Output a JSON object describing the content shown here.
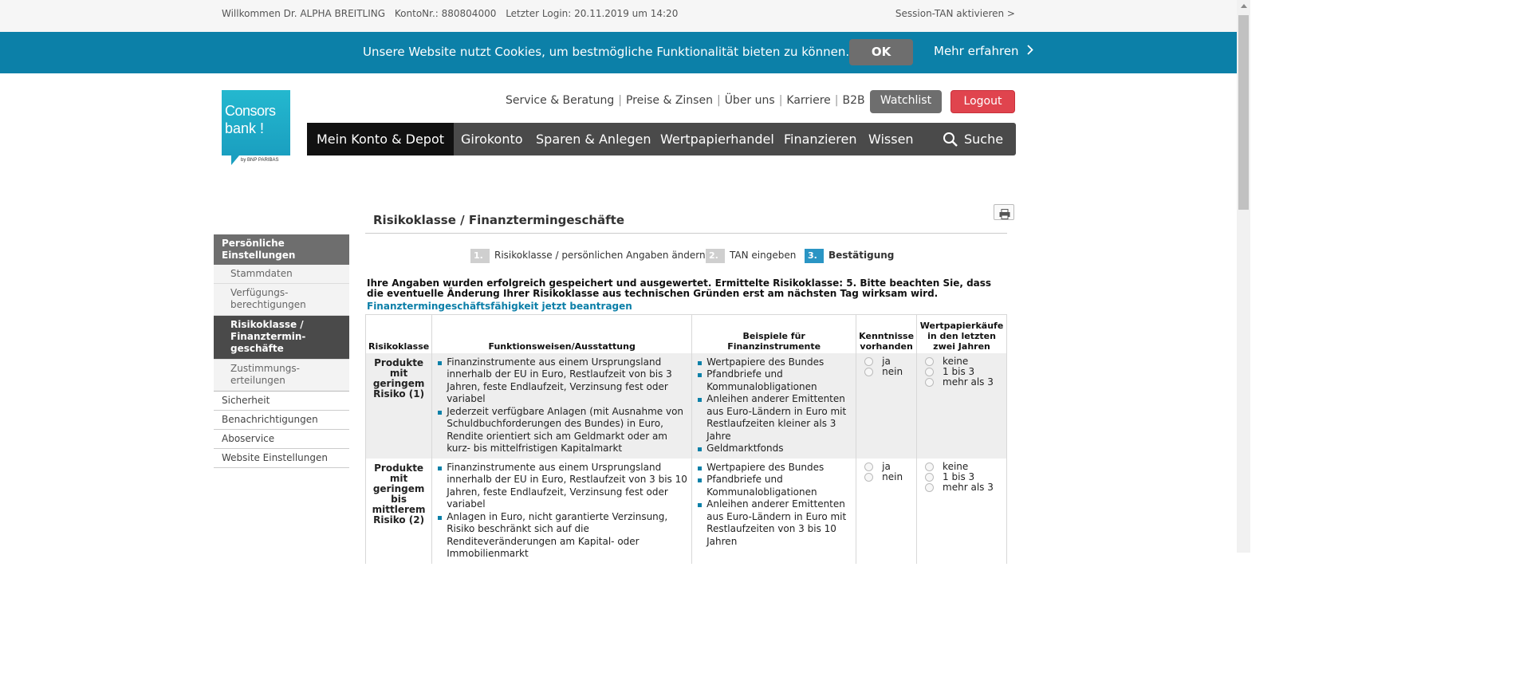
{
  "topbar": {
    "welcome": "Willkommen Dr. ALPHA BREITLING",
    "konto": "KontoNr.: 880804000",
    "login": "Letzter Login: 20.11.2019 um 14:20",
    "session": "Session-TAN aktivieren >"
  },
  "cookie": {
    "message": "Unsere Website nutzt Cookies, um bestmögliche Funktionalität bieten zu können.",
    "ok": "OK",
    "more": "Mehr erfahren"
  },
  "logo": {
    "line1": "Consors",
    "line2": "bank !",
    "sub": "by BNP PARIBAS"
  },
  "service": {
    "links": [
      "Service & Beratung",
      "Preise & Zinsen",
      "Über uns",
      "Karriere",
      "B2B"
    ],
    "watchlist": "Watchlist",
    "logout": "Logout"
  },
  "nav": {
    "items": [
      "Mein Konto & Depot",
      "Girokonto",
      "Sparen & Anlegen",
      "Wertpapierhandel",
      "Finanzieren",
      "Wissen"
    ],
    "search": "Suche"
  },
  "sidebar": {
    "section": "Persönliche Einstellungen",
    "subitems": [
      "Stammdaten",
      "Verfügungs-berechtigungen",
      "Risikoklasse / Finanztermin-geschäfte",
      "Zustimmungs-erteilungen"
    ],
    "items": [
      "Sicherheit",
      "Benachrichtigungen",
      "Aboservice",
      "Website Einstellungen"
    ]
  },
  "page": {
    "title": "Risikoklasse / Finanztermingeschäfte",
    "steps": [
      {
        "num": "1.",
        "label": "Risikoklasse / persönlichen Angaben ändern"
      },
      {
        "num": "2.",
        "label": "TAN eingeben"
      },
      {
        "num": "3.",
        "label": "Bestätigung"
      }
    ],
    "notice": "Ihre Angaben wurden erfolgreich gespeichert und ausgewertet. Ermittelte Risikoklasse: 5. Bitte beachten Sie, dass die eventuelle Änderung Ihrer Risikoklasse aus technischen Gründen erst am nächsten Tag wirksam wird.",
    "link": "Finanztermingeschäftsfähigkeit jetzt beantragen"
  },
  "table": {
    "headers": [
      "Risikoklasse",
      "Funktionsweisen/Ausstattung",
      "Beispiele für Finanzinstrumente",
      "Kenntnisse vorhanden",
      "Wertpapierkäufe in den letzten zwei Jahren"
    ],
    "rows": [
      {
        "class": "Produkte mit geringem Risiko (1)",
        "features": [
          "Finanzinstrumente aus einem Ursprungsland innerhalb der EU in Euro, Restlaufzeit von bis 3 Jahren, feste Endlaufzeit, Verzinsung fest oder variabel",
          "Jederzeit verfügbare Anlagen (mit Ausnahme von Schuldbuchforderungen des Bundes) in Euro, Rendite orientiert sich am Geldmarkt oder am kurz- bis mittelfristigen Kapitalmarkt"
        ],
        "examples": [
          "Wertpapiere des Bundes",
          "Pfandbriefe und Kommunalobligationen",
          "Anleihen anderer Emittenten aus Euro-Ländern in Euro mit Restlaufzeiten kleiner als 3 Jahre",
          "Geldmarktfonds"
        ],
        "knowledge": [
          "ja",
          "nein"
        ],
        "purchases": [
          "keine",
          "1 bis 3",
          "mehr als 3"
        ]
      },
      {
        "class": "Produkte mit geringem bis mittlerem Risiko (2)",
        "features": [
          "Finanzinstrumente aus einem Ursprungsland innerhalb der EU in Euro, Restlaufzeit von 3 bis 10 Jahren, feste Endlaufzeit, Verzinsung fest oder variabel",
          "Anlagen in Euro, nicht garantierte Verzinsung, Risiko beschränkt sich auf die Renditeveränderungen am Kapital- oder Immobilienmarkt"
        ],
        "examples": [
          "Wertpapiere des Bundes",
          "Pfandbriefe und Kommunalobligationen",
          "Anleihen anderer Emittenten aus Euro-Ländern in Euro mit Restlaufzeiten von 3 bis 10 Jahren"
        ],
        "knowledge": [
          "ja",
          "nein"
        ],
        "purchases": [
          "keine",
          "1 bis 3",
          "mehr als 3"
        ]
      }
    ]
  },
  "colors": {
    "brand": "#0c80a8",
    "logout": "#e0444e",
    "nav": "#4a4a4a"
  }
}
